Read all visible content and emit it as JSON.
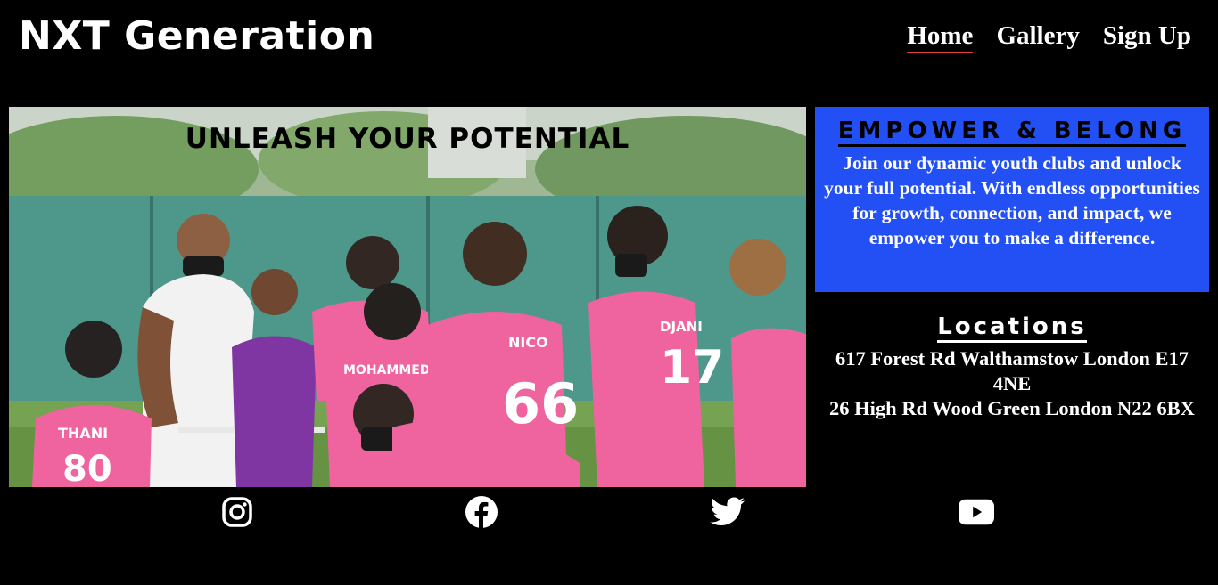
{
  "header": {
    "brand": "NXT Generation",
    "nav": [
      {
        "label": "Home",
        "active": true
      },
      {
        "label": "Gallery",
        "active": false
      },
      {
        "label": "Sign Up",
        "active": false
      }
    ]
  },
  "hero": {
    "heading": "UNLEASH YOUR POTENTIAL",
    "image_alt": "youth football team in pink shirts with coach"
  },
  "empower": {
    "title": "EMPOWER & BELONG",
    "text": "Join our dynamic youth clubs and unlock your full potential. With endless opportunities for growth, connection, and impact, we empower you to make a difference."
  },
  "locations": {
    "title": "Locations",
    "items": [
      "617 Forest Rd Walthamstow London E17 4NE",
      "26 High Rd Wood Green London N22 6BX"
    ]
  },
  "social": [
    {
      "icon": "instagram-icon"
    },
    {
      "icon": "facebook-icon"
    },
    {
      "icon": "twitter-icon"
    },
    {
      "icon": "youtube-icon"
    }
  ],
  "colors": {
    "background": "#000000",
    "empower_panel": "#2350f5",
    "nav_active_underline": "#e03b3b",
    "shirt_pink": "#ef5d9b"
  }
}
